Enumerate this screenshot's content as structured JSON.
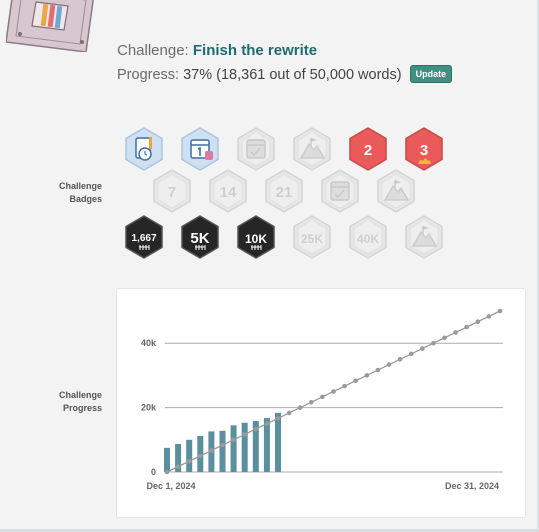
{
  "header": {
    "challenge_label": "Challenge:",
    "challenge_name": "Finish the rewrite",
    "progress_label": "Progress:",
    "progress_value": "37% (18,361 out of 50,000 words)",
    "update_label": "Update",
    "progress_fraction": 0.37
  },
  "badges": {
    "label_line1": "Challenge",
    "label_line2": "Badges",
    "rows": [
      [
        {
          "icon": "planner-clock-icon",
          "earned": true,
          "color": "#cfe0f3",
          "text": ""
        },
        {
          "icon": "calendar-day-one-icon",
          "earned": true,
          "color": "#cfe0f3",
          "text": ""
        },
        {
          "icon": "calendar-checklist-icon",
          "earned": false,
          "color": "#e6e6e6",
          "text": ""
        },
        {
          "icon": "mountain-flag-icon",
          "earned": false,
          "color": "#e6e6e6",
          "text": ""
        },
        {
          "icon": "streak-2-icon",
          "earned": true,
          "color": "#ea5a5a",
          "text": "2"
        },
        {
          "icon": "streak-3-icon",
          "earned": true,
          "color": "#ea5a5a",
          "text": "3"
        }
      ],
      [
        {
          "icon": "streak-7-icon",
          "earned": false,
          "color": "#e6e6e6",
          "text": "7"
        },
        {
          "icon": "streak-14-icon",
          "earned": false,
          "color": "#e6e6e6",
          "text": "14"
        },
        {
          "icon": "streak-21-icon",
          "earned": false,
          "color": "#e6e6e6",
          "text": "21"
        },
        {
          "icon": "calendar-done-icon",
          "earned": false,
          "color": "#e6e6e6",
          "text": ""
        },
        {
          "icon": "summit-flag-icon",
          "earned": false,
          "color": "#e6e6e6",
          "text": ""
        }
      ],
      [
        {
          "icon": "words-1667-icon",
          "earned": true,
          "color": "#262626",
          "text": "1,667"
        },
        {
          "icon": "words-5k-icon",
          "earned": true,
          "color": "#262626",
          "text": "5K"
        },
        {
          "icon": "words-10k-icon",
          "earned": true,
          "color": "#262626",
          "text": "10K"
        },
        {
          "icon": "words-25k-icon",
          "earned": false,
          "color": "#e6e6e6",
          "text": "25K"
        },
        {
          "icon": "words-40k-icon",
          "earned": false,
          "color": "#e6e6e6",
          "text": "40K"
        },
        {
          "icon": "tent-flag-icon",
          "earned": false,
          "color": "#e6e6e6",
          "text": ""
        }
      ]
    ]
  },
  "chart_label": {
    "line1": "Challenge",
    "line2": "Progress"
  },
  "chart_data": {
    "type": "bar",
    "x_start_label": "Dec 1, 2024",
    "x_end_label": "Dec 31, 2024",
    "ylim": [
      0,
      50000
    ],
    "yticks": [
      {
        "value": 0,
        "label": "0"
      },
      {
        "value": 20000,
        "label": "20k"
      },
      {
        "value": 40000,
        "label": "40k"
      }
    ],
    "days": 31,
    "bars": [
      7500,
      8700,
      10000,
      11200,
      12600,
      12800,
      14500,
      15300,
      15800,
      16800,
      18361
    ],
    "goal_line": {
      "from": 0,
      "to": 50000
    },
    "colors": {
      "bar": "#5a8fa0",
      "goal": "#9a9a9a",
      "grid": "#666666"
    }
  }
}
